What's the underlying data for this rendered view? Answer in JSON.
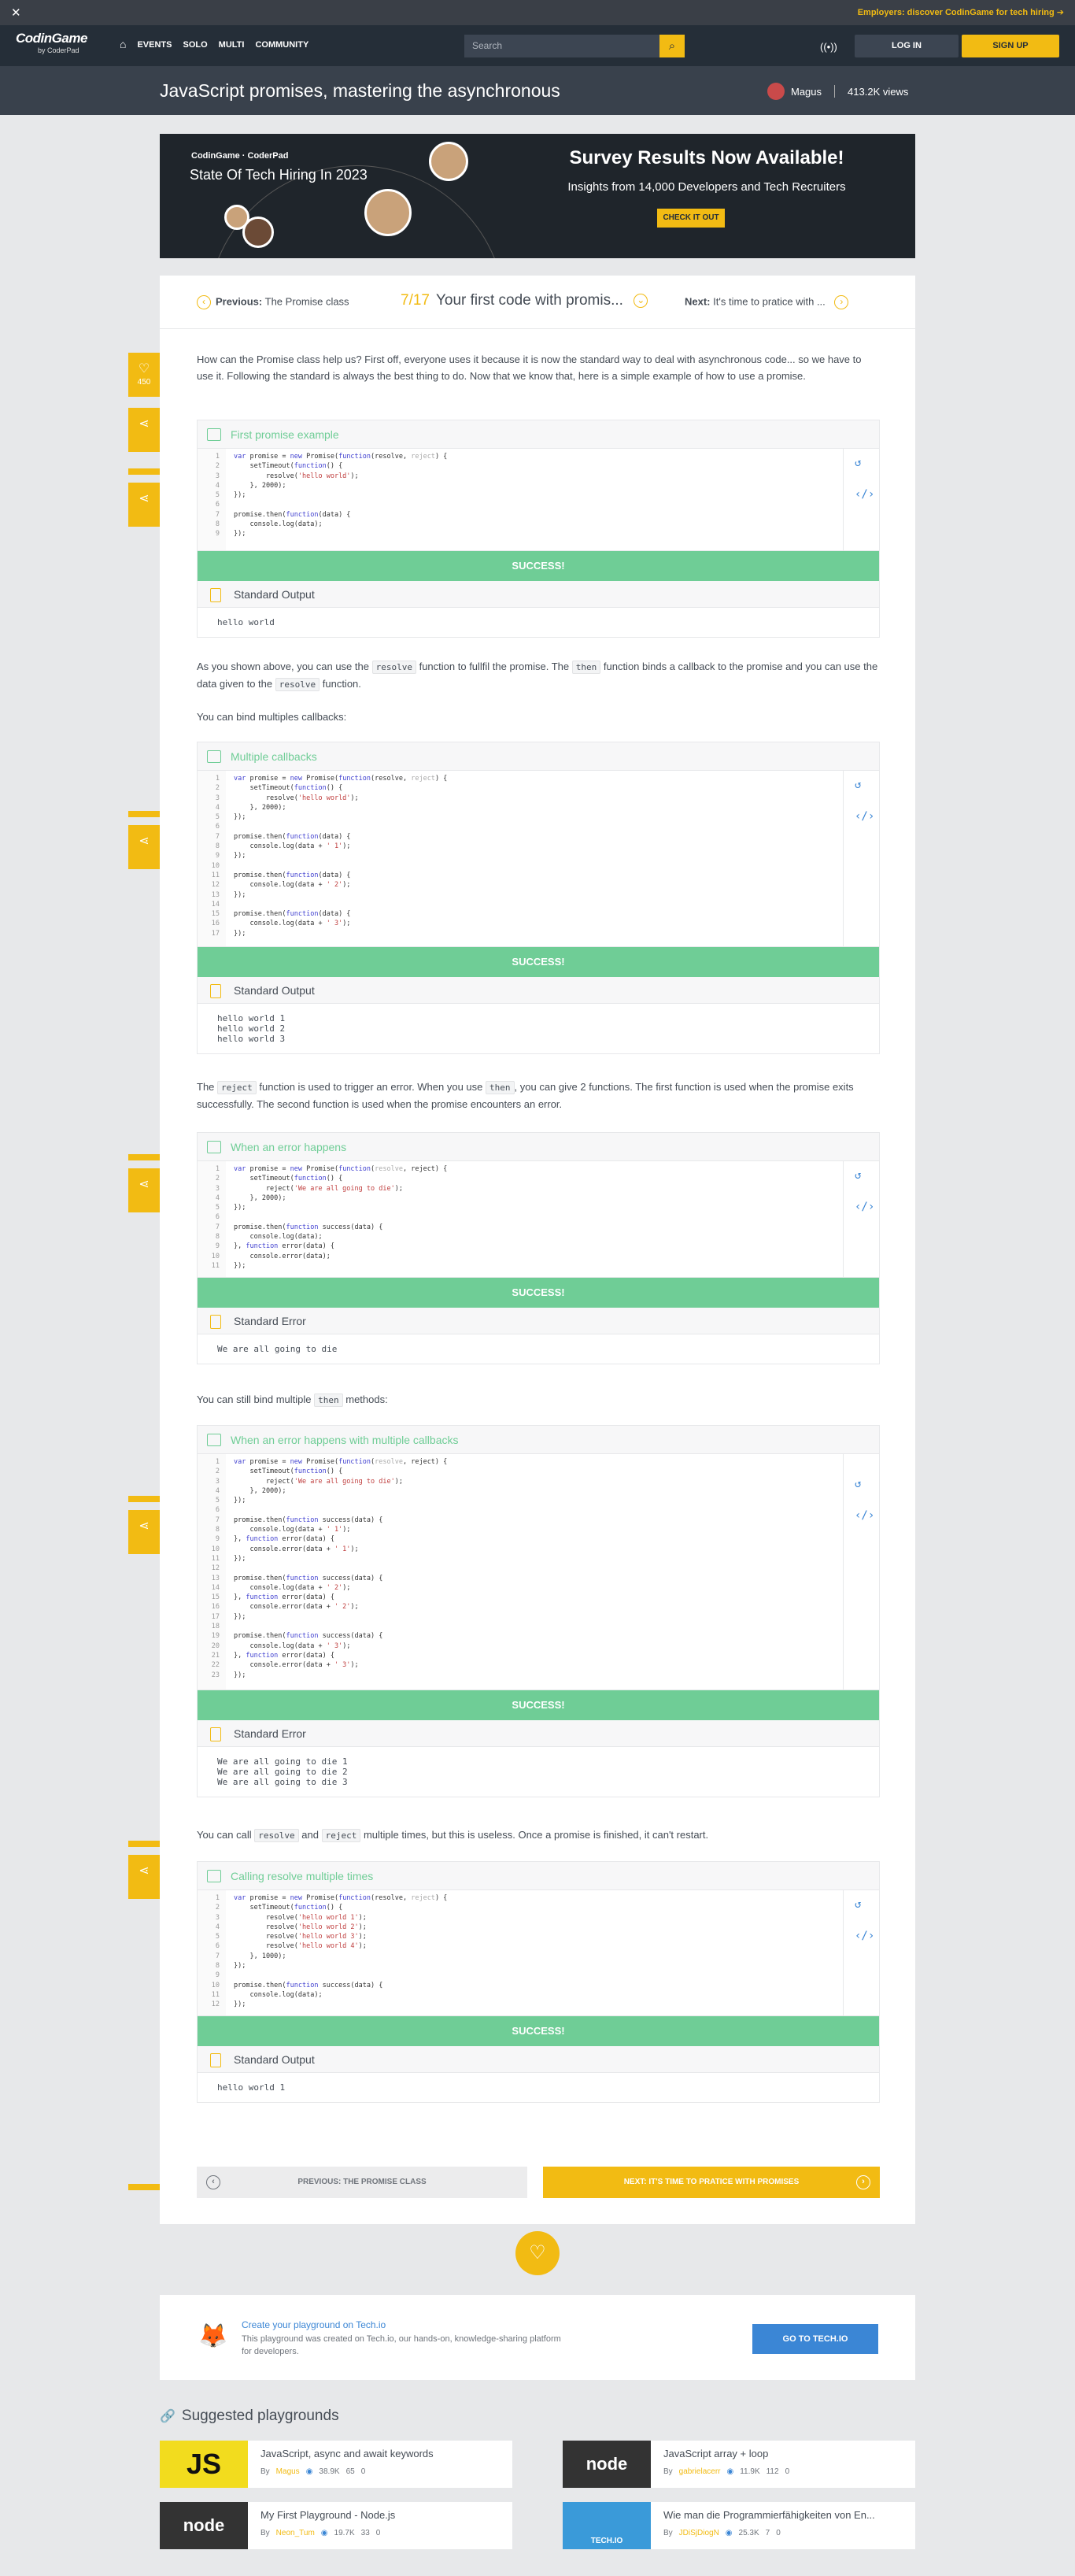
{
  "topbanner": {
    "close": "✕",
    "employers": "Employers: discover CodinGame for tech hiring ➔"
  },
  "nav": {
    "logo_main": "CodinGame",
    "logo_sub": "by CoderPad",
    "links": [
      "EVENTS",
      "SOLO",
      "MULTI",
      "COMMUNITY"
    ],
    "search_placeholder": "Search",
    "login": "LOG IN",
    "signup": "SIGN UP"
  },
  "header": {
    "title": "JavaScript promises, mastering the asynchronous",
    "author": "Magus",
    "views": "413.2K views"
  },
  "ad": {
    "logo": "CodinGame · CoderPad",
    "title": "State Of Tech Hiring In 2023",
    "headline": "Survey Results Now Available!",
    "sub": "Insights from 14,000 Developers and Tech Recruiters",
    "button": "CHECK IT OUT"
  },
  "lesson": {
    "prev_label": "Previous:",
    "prev_title": "The Promise class",
    "progress": "7/17",
    "current": "Your first code with promis...",
    "next_label": "Next:",
    "next_title": "It's time to pratice with ..."
  },
  "like_count": "450",
  "paragraphs": {
    "p1": "How can the Promise class help us? First off, everyone uses it because it is now the standard way to deal with asynchronous code... so we have to use it. Following the standard is always the best thing to do. Now that we know that, here is a simple example of how to use a promise.",
    "p2a": "As you shown above, you can use the",
    "p2b": "function to fullfil the promise. The",
    "p2c": "function binds a callback to the promise and you can use the data given to the",
    "p2d": "function.",
    "p3": "You can bind multiples callbacks:",
    "p4a": "The",
    "p4b": "function is used to trigger an error. When you use",
    "p4c": ", you can give 2 functions. The first function is used when the promise exits successfully. The second function is used when the promise encounters an error.",
    "p5a": "You can still bind multiple",
    "p5b": "methods:",
    "p6a": "You can call",
    "p6b": "and",
    "p6c": "multiple times, but this is useless. Once a promise is finished, it can't restart.",
    "code_resolve": "resolve",
    "code_then": "then",
    "code_reject": "reject"
  },
  "widgets": [
    {
      "title": "First promise example",
      "success": "SUCCESS!",
      "out_title": "Standard Output",
      "output": "hello world"
    },
    {
      "title": "Multiple callbacks",
      "success": "SUCCESS!",
      "out_title": "Standard Output",
      "output": "hello world 1\nhello world 2\nhello world 3"
    },
    {
      "title": "When an error happens",
      "success": "SUCCESS!",
      "out_title": "Standard Error",
      "output": "We are all going to die"
    },
    {
      "title": "When an error happens with multiple callbacks",
      "success": "SUCCESS!",
      "out_title": "Standard Error",
      "output": "We are all going to die 1\nWe are all going to die 2\nWe are all going to die 3"
    },
    {
      "title": "Calling resolve multiple times",
      "success": "SUCCESS!",
      "out_title": "Standard Output",
      "output": "hello world 1"
    }
  ],
  "bottom_nav": {
    "prev": "PREVIOUS: THE PROMISE CLASS",
    "next": "NEXT: IT'S TIME TO PRATICE WITH PROMISES"
  },
  "techio": {
    "title": "Create your playground on Tech.io",
    "desc": "This playground was created on Tech.io, our hands-on, knowledge-sharing platform for developers.",
    "button": "GO TO TECH.IO"
  },
  "suggested": {
    "heading": "Suggested playgrounds",
    "cards": [
      {
        "thumb": "JS",
        "title": "JavaScript, async and await keywords",
        "author": "Magus",
        "views": "38.9K",
        "likes": "65",
        "comments": "0"
      },
      {
        "thumb": "node",
        "title": "JavaScript array + loop",
        "author": "gabrielacerr",
        "views": "11.9K",
        "likes": "112",
        "comments": "0"
      },
      {
        "thumb": "node",
        "title": "My First Playground - Node.js",
        "author": "Neon_Tum",
        "views": "19.7K",
        "likes": "33",
        "comments": "0"
      },
      {
        "thumb": "TECH.IO",
        "title": "Wie man die Programmierfähigkeiten von En...",
        "author": "JDiSjDiogN",
        "views": "25.3K",
        "likes": "7",
        "comments": "0"
      }
    ]
  },
  "colors": {
    "accent": "#f2bb13",
    "success": "#6fcd96",
    "link": "#3b86d5",
    "header": "#252e38"
  }
}
